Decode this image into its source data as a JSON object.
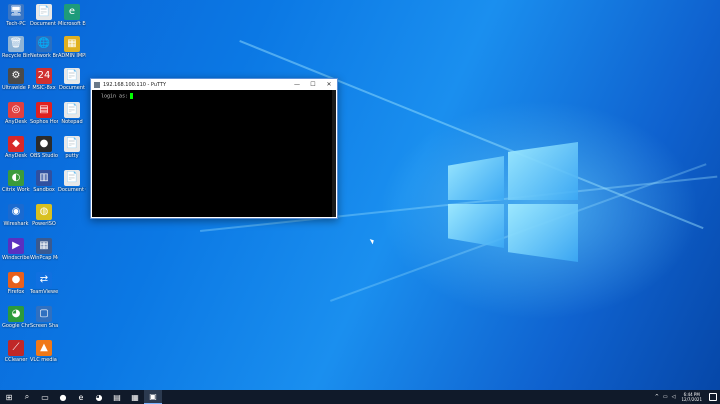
{
  "desktop": {
    "icons": [
      {
        "label": "Tech-PC",
        "glyph": "🖥",
        "color": "#3a76c4"
      },
      {
        "label": "Document - Copy",
        "glyph": "📄",
        "color": "#e8e8e8"
      },
      {
        "label": "Microsoft Edge",
        "glyph": "e",
        "color": "#1e9b7a"
      },
      {
        "label": "Recycle Bin",
        "glyph": "🗑",
        "color": "#8fb4d6"
      },
      {
        "label": "Network Broadcaster",
        "glyph": "🌐",
        "color": "#2a6fc0"
      },
      {
        "label": "ADMIN IMPRESSIONS",
        "glyph": "▦",
        "color": "#e0b020"
      },
      {
        "label": "Ultrawide Profile",
        "glyph": "⚙",
        "color": "#4a4a4a"
      },
      {
        "label": "MSIC-8xx",
        "glyph": "24",
        "color": "#d03030"
      },
      {
        "label": "Document",
        "glyph": "📄",
        "color": "#e8e8e8"
      },
      {
        "label": "AnyDesk",
        "glyph": "◎",
        "color": "#e24040"
      },
      {
        "label": "Sophos Home",
        "glyph": "▤",
        "color": "#e02020"
      },
      {
        "label": "Notepad",
        "glyph": "📄",
        "color": "#e8e8e8"
      },
      {
        "label": "AnyDesk",
        "glyph": "◆",
        "color": "#d82828"
      },
      {
        "label": "OBS Studio",
        "glyph": "●",
        "color": "#2b2b2b"
      },
      {
        "label": "putty",
        "glyph": "📄",
        "color": "#e8e8e8"
      },
      {
        "label": "Citrix Workspace",
        "glyph": "◐",
        "color": "#3b9b3b"
      },
      {
        "label": "Sandbox",
        "glyph": "▥",
        "color": "#3050a0"
      },
      {
        "label": "Document Online",
        "glyph": "📄",
        "color": "#e8e8e8"
      },
      {
        "label": "Wireshark",
        "glyph": "◉",
        "color": "#1a6ad0"
      },
      {
        "label": "PowerISO",
        "glyph": "◍",
        "color": "#d8c020"
      },
      {
        "label": "Windscribe Video Converter",
        "glyph": "▶",
        "color": "#5a30c0"
      },
      {
        "label": "WinPcap Monitor",
        "glyph": "▦",
        "color": "#3a5a90"
      },
      {
        "label": "Firefox",
        "glyph": "●",
        "color": "#e8601c"
      },
      {
        "label": "TeamViewer",
        "glyph": "⇄",
        "color": "#1070e0"
      },
      {
        "label": "Google Chrome",
        "glyph": "◕",
        "color": "#2c9a3c"
      },
      {
        "label": "Screen Share",
        "glyph": "▢",
        "color": "#3070c0"
      },
      {
        "label": "CCleaner",
        "glyph": "⟋",
        "color": "#c02828"
      },
      {
        "label": "VLC media player",
        "glyph": "▲",
        "color": "#f07818"
      }
    ]
  },
  "putty": {
    "title": "192.168.100.110 - PuTTY",
    "prompt": "login as:",
    "minimize": "—",
    "maximize": "☐",
    "close": "✕"
  },
  "taskbar": {
    "start_glyph": "⊞",
    "items": [
      {
        "name": "search",
        "glyph": "⌕"
      },
      {
        "name": "task-view",
        "glyph": "▭"
      },
      {
        "name": "firefox",
        "glyph": "●"
      },
      {
        "name": "edge",
        "glyph": "e"
      },
      {
        "name": "chrome",
        "glyph": "◕"
      },
      {
        "name": "file-explorer",
        "glyph": "▤"
      },
      {
        "name": "store",
        "glyph": "▦"
      },
      {
        "name": "putty",
        "glyph": "▣",
        "active": true
      }
    ],
    "tray": {
      "caret": "^",
      "network": "▭",
      "volume": "◁",
      "time": "6:44 PM",
      "date": "12/7/2021"
    }
  }
}
